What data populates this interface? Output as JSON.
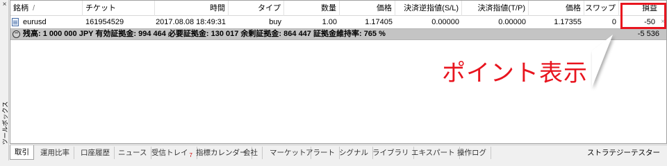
{
  "sidebar": {
    "close_glyph": "×",
    "title": "ツールボックス"
  },
  "columns": [
    {
      "label": "銘柄"
    },
    {
      "label": "チケット"
    },
    {
      "label": "時間"
    },
    {
      "label": "タイプ"
    },
    {
      "label": "数量"
    },
    {
      "label": "価格"
    },
    {
      "label": "決済逆指値(S/L)"
    },
    {
      "label": "決済指値(T/P)"
    },
    {
      "label": "価格"
    },
    {
      "label": "スワップ"
    },
    {
      "label": "損益"
    }
  ],
  "sort_indicator": "/",
  "order": {
    "symbol": "eurusd",
    "ticket": "161954529",
    "time": "2017.08.08 18:49:31",
    "type": "buy",
    "volume": "1.00",
    "price": "1.17405",
    "sl": "0.00000",
    "tp": "0.00000",
    "current_price": "1.17355",
    "swap": "0",
    "profit": "-50",
    "close_glyph": "×"
  },
  "summary": {
    "collapse_glyph": "−",
    "text": "残高: 1 000 000 JPY  有効証拠金: 994 464  必要証拠金: 130 017  余剰証拠金: 864 447  証拠金維持率: 765 %",
    "total": "-5 536"
  },
  "annotation": {
    "label": "ポイント表示",
    "color": "#e8141e"
  },
  "tabs": [
    {
      "label": "取引",
      "active": true
    },
    {
      "label": "運用比率"
    },
    {
      "label": "口座履歴"
    },
    {
      "label": "ニュース"
    },
    {
      "label": "受信トレイ",
      "badge": "7"
    },
    {
      "label": "指標カレンダー"
    },
    {
      "label": "会社"
    },
    {
      "label": "マーケット"
    },
    {
      "label": "アラート"
    },
    {
      "label": "シグナル"
    },
    {
      "label": "ライブラリ"
    },
    {
      "label": "エキスパート"
    },
    {
      "label": "操作ログ"
    }
  ],
  "tester_tab": {
    "label": "ストラテジーテスター"
  }
}
